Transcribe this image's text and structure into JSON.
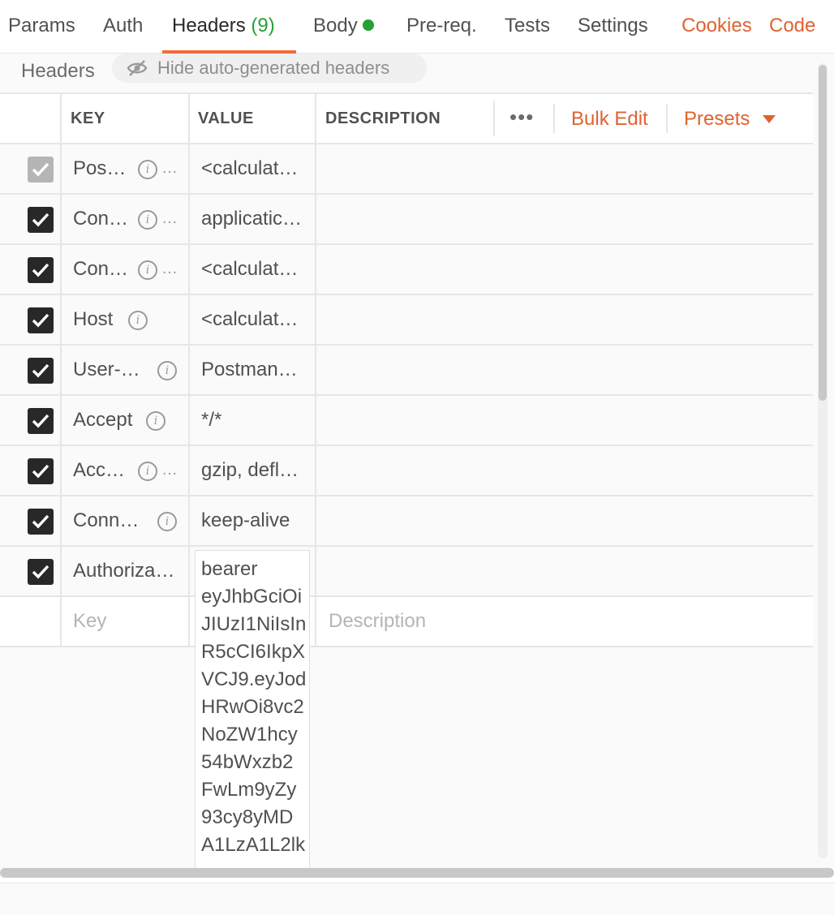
{
  "tabs": {
    "params": "Params",
    "auth": "Auth",
    "headers": "Headers",
    "headers_count": "(9)",
    "body": "Body",
    "prereq": "Pre-req.",
    "tests": "Tests",
    "settings": "Settings",
    "cookies": "Cookies",
    "code": "Code"
  },
  "section": {
    "title": "Headers",
    "hide_auto": "Hide auto-generated headers",
    "hide_icon": "eye-slash-icon"
  },
  "table": {
    "col_key": "KEY",
    "col_value": "VALUE",
    "col_description": "DESCRIPTION",
    "more": "•••",
    "bulk_edit": "Bulk Edit",
    "presets": "Presets",
    "rows": [
      {
        "key": "Pos…",
        "value": "<calculat…",
        "checked": true,
        "disabled": true
      },
      {
        "key": "Con…",
        "value": "applicatic…",
        "checked": true,
        "disabled": false
      },
      {
        "key": "Con…",
        "value": "<calculat…",
        "checked": true,
        "disabled": false
      },
      {
        "key": "Host",
        "value": "<calculat…",
        "checked": true,
        "disabled": false
      },
      {
        "key": "User-…",
        "value": "Postman…",
        "checked": true,
        "disabled": false
      },
      {
        "key": "Accept",
        "value": "*/*",
        "checked": true,
        "disabled": false
      },
      {
        "key": "Acc…",
        "value": "gzip, defl…",
        "checked": true,
        "disabled": false
      },
      {
        "key": "Conn…",
        "value": "keep-alive",
        "checked": true,
        "disabled": false
      },
      {
        "key": "Authoriza…",
        "value": "",
        "checked": true,
        "disabled": false
      }
    ],
    "new_key_placeholder": "Key",
    "new_description_placeholder": "Description",
    "auth_value_lines": [
      "bearer",
      "eyJhbGciOi",
      "JIUzI1NiIsIn",
      "R5cCI6IkpX",
      "VCJ9.eyJod",
      "HRwOi8vc2",
      "NoZW1hcy",
      "54bWxzb2",
      "FwLm9yZy",
      "93cy8yMD",
      "A1LzA1L2lk"
    ]
  },
  "colors": {
    "accent": "#e0622f",
    "active_underline": "#f26b3a",
    "count_green": "#26a135"
  }
}
